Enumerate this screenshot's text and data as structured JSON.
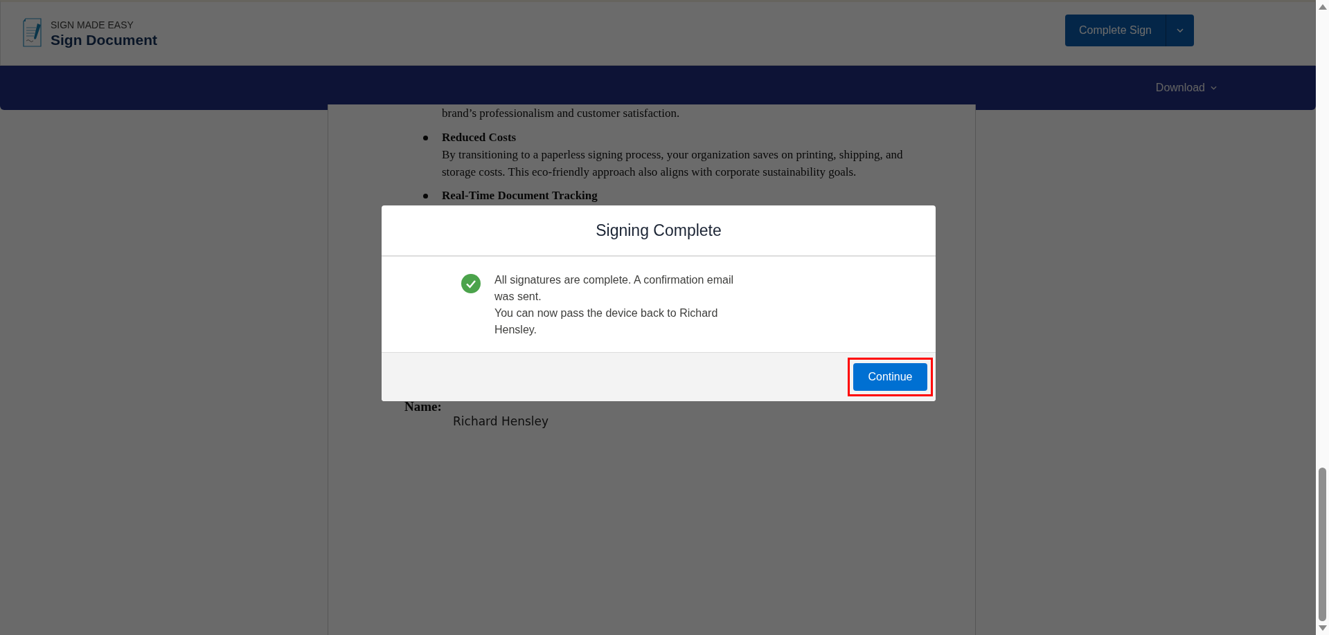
{
  "app": {
    "brand": "SIGN MADE EASY",
    "title": "Sign Document"
  },
  "actions": {
    "complete_sign": "Complete Sign"
  },
  "nav": {
    "download": "Download"
  },
  "document": {
    "paragraph_tail": "brand’s professionalism and customer satisfaction.",
    "bullets": [
      {
        "title": "Reduced Costs",
        "text": "By transitioning to a paperless signing process, your organization saves on printing, shipping, and storage costs. This eco-friendly approach also aligns with corporate sustainability goals."
      },
      {
        "title": "Real-Time Document Tracking"
      }
    ],
    "name_label": "Name:",
    "signer_name": "Richard Hensley"
  },
  "dialog": {
    "title": "Signing Complete",
    "messages": [
      "All signatures are complete. A confirmation email was sent.",
      "You can now pass the device back to Richard Hensley."
    ],
    "button": {
      "label": "Continue",
      "highlighted": true
    }
  }
}
